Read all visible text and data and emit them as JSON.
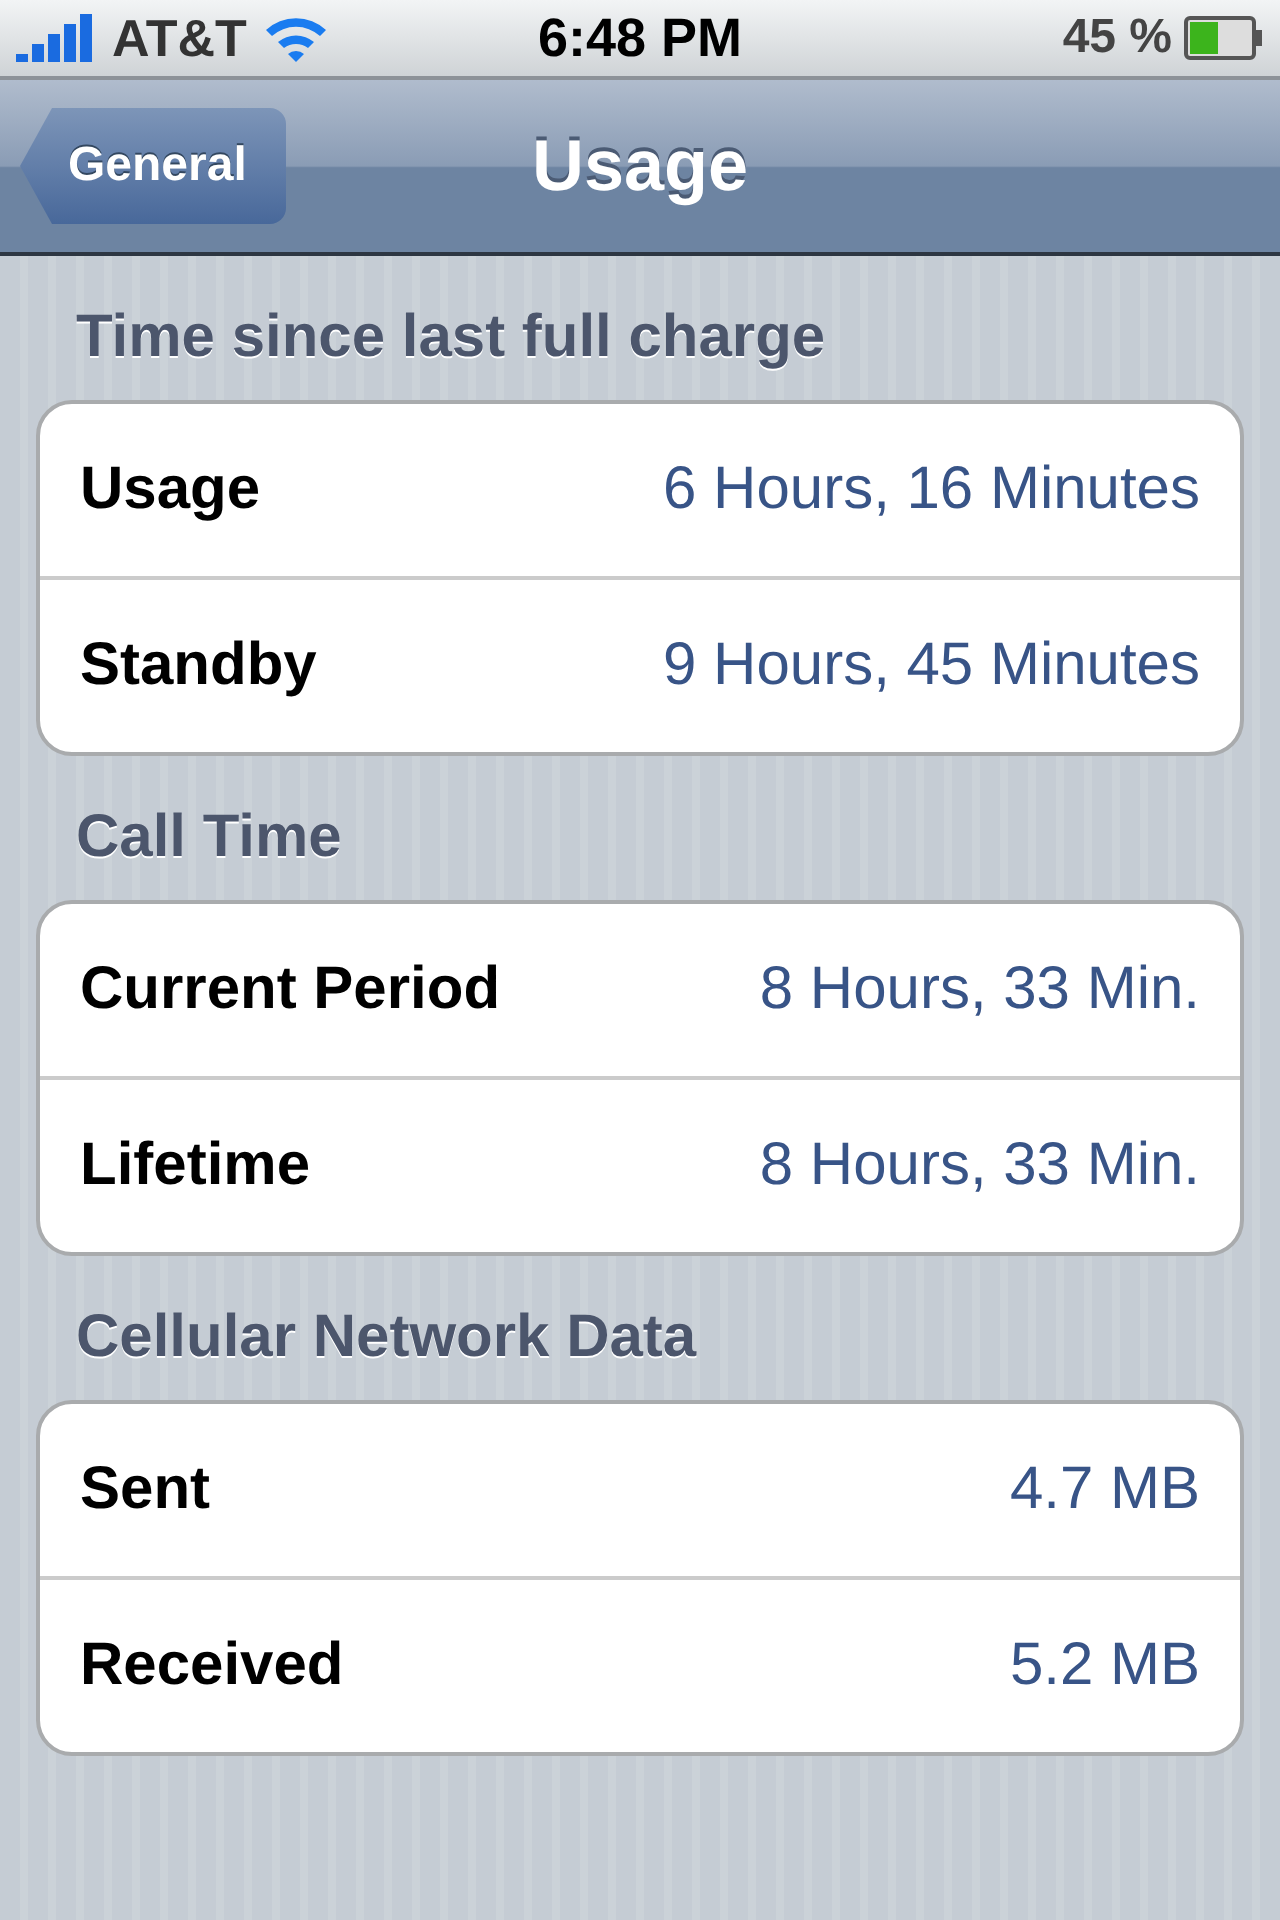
{
  "status_bar": {
    "carrier": "AT&T",
    "time": "6:48 PM",
    "battery": "45 %"
  },
  "nav_bar": {
    "back": "General",
    "title": "Usage"
  },
  "sections": [
    {
      "header": "Time since last full charge",
      "rows": [
        {
          "label": "Usage",
          "value": "6 Hours, 16 Minutes"
        },
        {
          "label": "Standby",
          "value": "9 Hours, 45 Minutes"
        }
      ]
    },
    {
      "header": "Call Time",
      "rows": [
        {
          "label": "Current Period",
          "value": "8 Hours, 33 Min."
        },
        {
          "label": "Lifetime",
          "value": "8 Hours, 33 Min."
        }
      ]
    },
    {
      "header": "Cellular Network Data",
      "rows": [
        {
          "label": "Sent",
          "value": "4.7 MB"
        },
        {
          "label": "Received",
          "value": "5.2 MB"
        }
      ]
    }
  ]
}
